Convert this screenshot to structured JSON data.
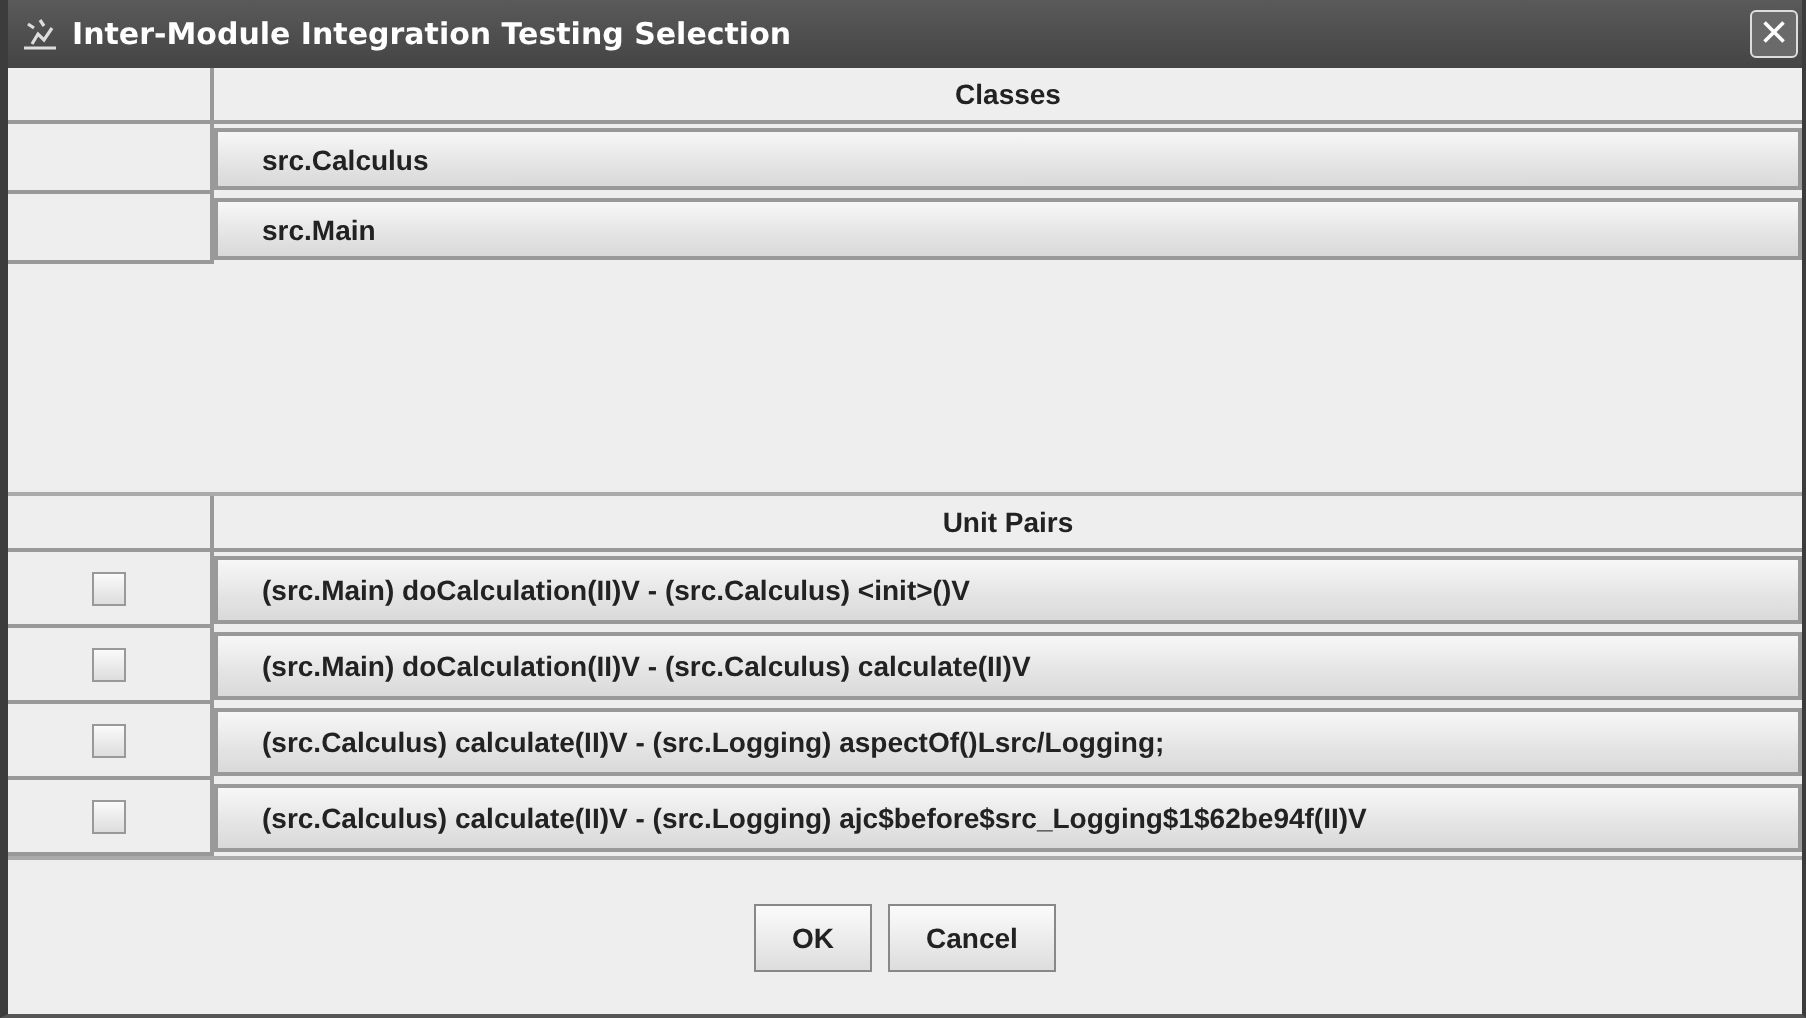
{
  "window": {
    "title": "Inter-Module Integration Testing Selection",
    "close": "×"
  },
  "classes": {
    "column": "Classes",
    "rows": [
      {
        "name": "src.Calculus"
      },
      {
        "name": "src.Main"
      }
    ]
  },
  "unit_pairs": {
    "column": "Unit Pairs",
    "rows": [
      {
        "name": "(src.Main) doCalculation(II)V - (src.Calculus) <init>()V",
        "checked": false
      },
      {
        "name": "(src.Main) doCalculation(II)V - (src.Calculus) calculate(II)V",
        "checked": false
      },
      {
        "name": "(src.Calculus) calculate(II)V - (src.Logging) aspectOf()Lsrc/Logging;",
        "checked": false
      },
      {
        "name": "(src.Calculus) calculate(II)V - (src.Logging) ajc$before$src_Logging$1$62be94f(II)V",
        "checked": false
      }
    ]
  },
  "buttons": [
    "OK",
    "Cancel"
  ]
}
